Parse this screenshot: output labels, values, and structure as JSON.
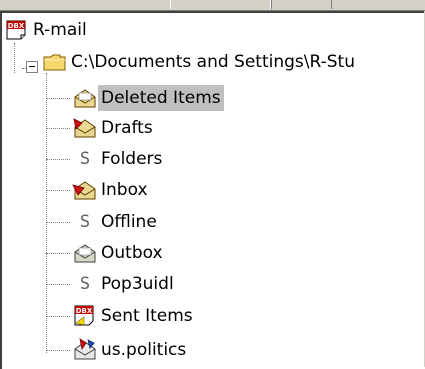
{
  "tree": {
    "root": {
      "label": "R-mail",
      "icon": "dbx-icon"
    },
    "store": {
      "label": "C:\\Documents and Settings\\R-Stu",
      "icon": "folder-icon"
    },
    "items": [
      {
        "label": "Deleted Items",
        "icon": "open-envelope-icon",
        "selected": true
      },
      {
        "label": "Drafts",
        "icon": "red-flag-envelope-icon",
        "selected": false
      },
      {
        "label": "Folders",
        "icon": "s-glyph-icon",
        "selected": false
      },
      {
        "label": "Inbox",
        "icon": "red-envelope-icon",
        "selected": false
      },
      {
        "label": "Offline",
        "icon": "s-glyph-icon",
        "selected": false
      },
      {
        "label": "Outbox",
        "icon": "open-envelope-icon",
        "selected": false
      },
      {
        "label": "Pop3uidl",
        "icon": "s-glyph-icon",
        "selected": false
      },
      {
        "label": "Sent Items",
        "icon": "dbx-icon",
        "selected": false
      },
      {
        "label": "us.politics",
        "icon": "newsgroup-icon",
        "selected": false
      }
    ],
    "s_glyph": "S"
  },
  "colors": {
    "selection": "#c0c0c0",
    "folder_yellow": "#f5d76e",
    "envelope_red": "#d01010",
    "dbx_red": "#c00000"
  }
}
